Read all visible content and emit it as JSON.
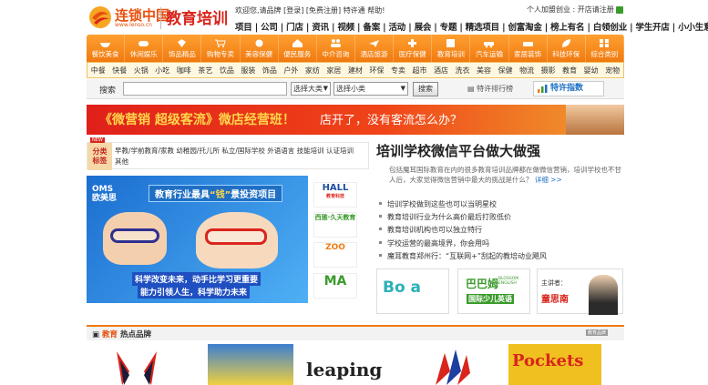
{
  "header": {
    "logo_text": "连锁中国",
    "logo_url": "www.lenso.cn",
    "site_section": "教育培训",
    "welcome_prefix": "欢迎您,请品牌",
    "login_link": "[登录]",
    "register_link": "[免费注册]",
    "special_link": "特许通",
    "help_link": "帮助!",
    "join_text": "个人加盟创业 : 开店请注册",
    "top_nav": "项目 | 公司 | 门店 | 资讯 | 视频 | 备案 | 活动 | 展会 | 专题 | 精选项目 | 创富淘金 | 榜上有名 | 白领创业 | 学生开店 | 小小生意"
  },
  "icon_nav": [
    {
      "label": "餐饮美食",
      "icon": "bowl-icon"
    },
    {
      "label": "休闲娱乐",
      "icon": "gamepad-icon"
    },
    {
      "label": "饰品精品",
      "icon": "gem-icon"
    },
    {
      "label": "购物专卖",
      "icon": "cart-icon"
    },
    {
      "label": "美容保健",
      "icon": "flower-icon"
    },
    {
      "label": "便民服务",
      "icon": "home-icon"
    },
    {
      "label": "中介咨询",
      "icon": "people-icon"
    },
    {
      "label": "酒店旅游",
      "icon": "plane-icon"
    },
    {
      "label": "医疗保健",
      "icon": "cross-icon"
    },
    {
      "label": "教育培训",
      "icon": "book-icon"
    },
    {
      "label": "汽车运输",
      "icon": "car-icon"
    },
    {
      "label": "家居装饰",
      "icon": "sofa-icon"
    },
    {
      "label": "科技环保",
      "icon": "leaf-icon"
    },
    {
      "label": "综合类别",
      "icon": "grid-icon"
    }
  ],
  "categories": [
    "中餐",
    "快餐",
    "火锅",
    "小吃",
    "咖啡",
    "茶艺",
    "饮品",
    "服装",
    "饰品",
    "户外",
    "家纺",
    "家居",
    "建材",
    "环保",
    "专卖",
    "超市",
    "酒店",
    "洗衣",
    "美容",
    "保健",
    "物流",
    "摄影",
    "教育",
    "婴幼",
    "宠物"
  ],
  "search": {
    "label": "搜索",
    "placeholder": "",
    "select_major": "选择大类",
    "select_minor": "选择小类",
    "button": "搜索",
    "rank_link": "特许排行榜",
    "index_link": "特许指数"
  },
  "banner": {
    "slogan_left": "《微营销 超级客流》微店经营班！",
    "slogan_right": "店开了，没有客流怎么办？"
  },
  "category_box": {
    "new_badge": "NEW",
    "tag_line1": "分类",
    "tag_line2": "标签",
    "links": "早教/学前教育/家教 幼稚园/托儿所 私立/国际学校 外语语言 技能培训 认证培训 其他"
  },
  "ad": {
    "brand_line1": "OMS",
    "brand_line2": "欧美思",
    "title_prefix": "教育行业最具",
    "title_quote": "“钱”",
    "title_suffix": "景投资项目",
    "slogan1": "科学改变未来，动手比学习更重要",
    "slogan2": "能力引领人生，科学助力未来"
  },
  "side_logos": [
    {
      "name": "HALL",
      "sub": "教育科技"
    },
    {
      "name": "西雅·久天教育",
      "sub": ""
    },
    {
      "name": "ZOO",
      "sub": ""
    },
    {
      "name": "MA",
      "sub": ""
    }
  ],
  "headline": {
    "title": "培训学校微信平台做大做强",
    "desc": "包括魔耳国际教育在内的很多教育培训品牌都在做微信营销，培训学校也不甘人后，大家觉得微信营销中最大的挑战是什么？",
    "more": "详细 >>"
  },
  "news": [
    "培训学校做到这些也可以当明星校",
    "教育培训行业为什么高价最后打败低价",
    "教育培训机构也可以独立特行",
    "学校运营的最高境界，你会用吗",
    "魔耳教育郑州行：“互联网+”刮起的教培动业飓风"
  ],
  "brand_cards": {
    "boa": "Bo a",
    "bbm_cn": "巴巴姆",
    "bbm_en": "BLOSSOM ENGLISH",
    "bbm_sub": "国际少儿英语",
    "speaker_label": "主讲者：",
    "speaker_name": "童思南"
  },
  "hot": {
    "title_prefix": "教育",
    "title_suffix": "热点品牌",
    "more": "教育品牌",
    "brands": [
      "",
      "",
      "leaping",
      "",
      "Pockets"
    ]
  },
  "colors": {
    "brand_orange": "#f07a10",
    "brand_red": "#d9251c",
    "link_blue": "#1d6fc2"
  }
}
